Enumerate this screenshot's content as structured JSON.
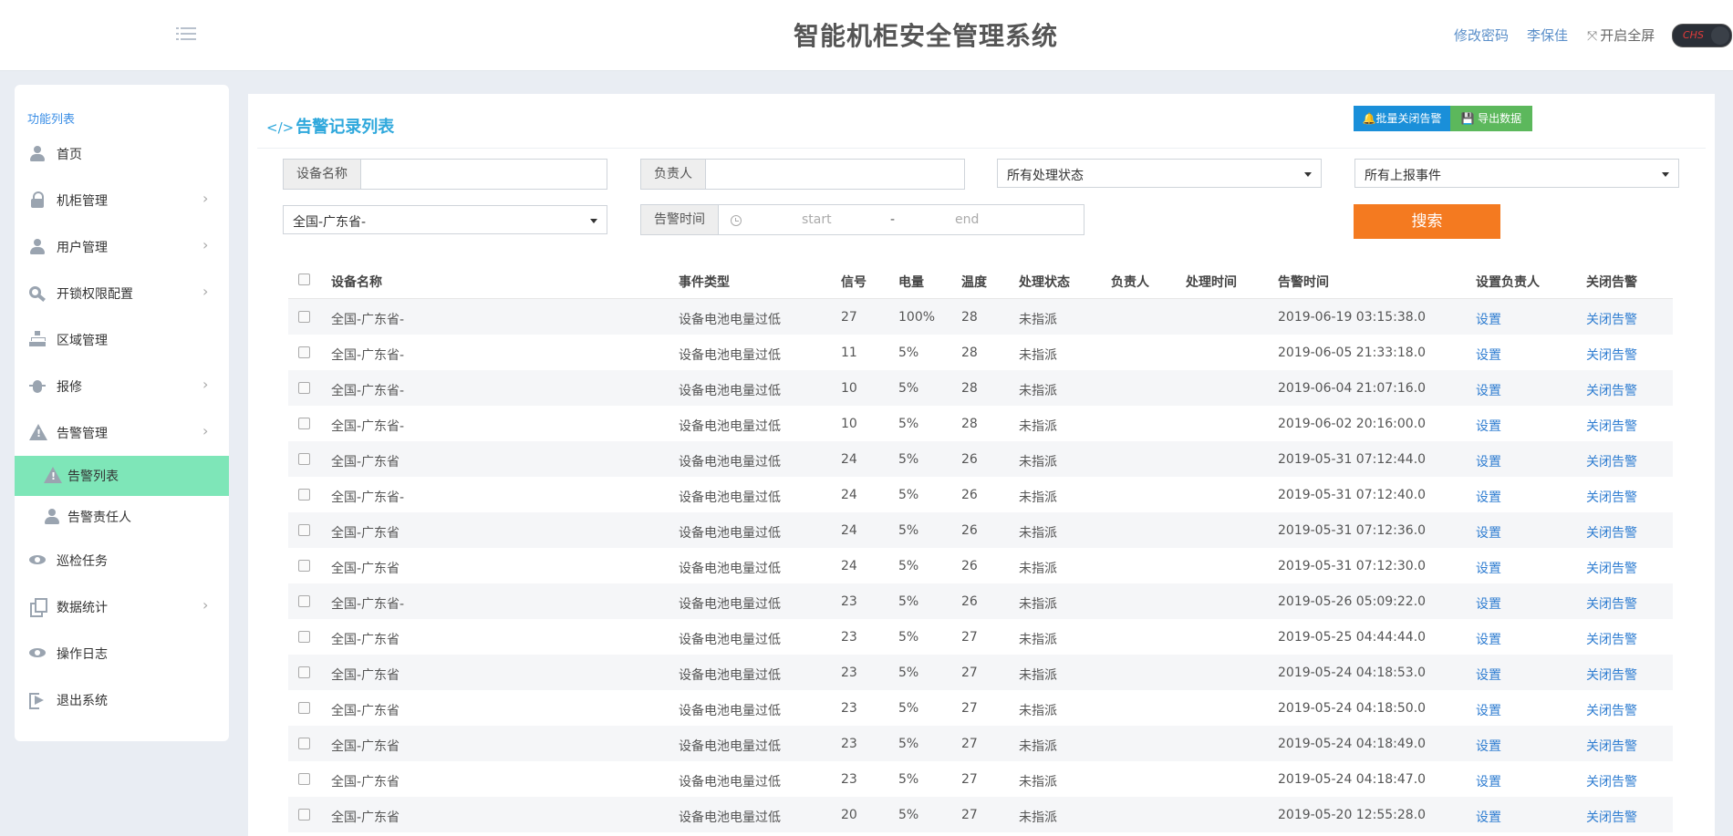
{
  "header": {
    "title": "智能机柜安全管理系统",
    "change_password": "修改密码",
    "user_name": "李保佳",
    "fullscreen": "开启全屏",
    "lang": "CHS"
  },
  "sidebar": {
    "header": "功能列表",
    "items": [
      {
        "label": "首页",
        "icon": "user-icon"
      },
      {
        "label": "机柜管理",
        "icon": "lock-icon"
      },
      {
        "label": "用户管理",
        "icon": "user-icon"
      },
      {
        "label": "开锁权限配置",
        "icon": "key-icon"
      },
      {
        "label": "区域管理",
        "icon": "sitemap-icon"
      },
      {
        "label": "报修",
        "icon": "bug-icon"
      },
      {
        "label": "告警管理",
        "icon": "warning-icon"
      },
      {
        "label": "告警列表",
        "icon": "warning-icon"
      },
      {
        "label": "告警责任人",
        "icon": "user-icon"
      },
      {
        "label": "巡检任务",
        "icon": "eye-icon"
      },
      {
        "label": "数据统计",
        "icon": "copy-icon"
      },
      {
        "label": "操作日志",
        "icon": "eye-icon"
      },
      {
        "label": "退出系统",
        "icon": "sign-out-icon"
      }
    ],
    "active_color": "#7ee6b8"
  },
  "main": {
    "title": "告警记录列表",
    "title_prefix": "</>",
    "batch_close_label": "批量关闭告警",
    "export_label": "导出数据",
    "filters": {
      "device_name_label": "设备名称",
      "device_name_value": "",
      "owner_label": "负责人",
      "owner_value": "",
      "status_select": "所有处理状态",
      "event_select": "所有上报事件",
      "region_select": "全国-广东省-",
      "alarm_time_label": "告警时间",
      "time_start_placeholder": "start",
      "time_sep": "-",
      "time_end_placeholder": "end",
      "search_label": "搜索"
    },
    "table": {
      "columns": [
        "设备名称",
        "事件类型",
        "信号",
        "电量",
        "温度",
        "处理状态",
        "负责人",
        "处理时间",
        "告警时间",
        "设置负责人",
        "关闭告警"
      ],
      "rows": [
        {
          "device": "全国-广东省-",
          "event": "设备电池电量过低",
          "signal": "27",
          "battery": "100%",
          "temp": "28",
          "status": "未指派",
          "owner": "",
          "handled": "",
          "time": "2019-06-19 03:15:38.0",
          "set": "设置",
          "close": "关闭告警"
        },
        {
          "device": "全国-广东省-",
          "event": "设备电池电量过低",
          "signal": "11",
          "battery": "5%",
          "temp": "28",
          "status": "未指派",
          "owner": "",
          "handled": "",
          "time": "2019-06-05 21:33:18.0",
          "set": "设置",
          "close": "关闭告警"
        },
        {
          "device": "全国-广东省-",
          "event": "设备电池电量过低",
          "signal": "10",
          "battery": "5%",
          "temp": "28",
          "status": "未指派",
          "owner": "",
          "handled": "",
          "time": "2019-06-04 21:07:16.0",
          "set": "设置",
          "close": "关闭告警"
        },
        {
          "device": "全国-广东省-",
          "event": "设备电池电量过低",
          "signal": "10",
          "battery": "5%",
          "temp": "28",
          "status": "未指派",
          "owner": "",
          "handled": "",
          "time": "2019-06-02 20:16:00.0",
          "set": "设置",
          "close": "关闭告警"
        },
        {
          "device": "全国-广东省",
          "event": "设备电池电量过低",
          "signal": "24",
          "battery": "5%",
          "temp": "26",
          "status": "未指派",
          "owner": "",
          "handled": "",
          "time": "2019-05-31 07:12:44.0",
          "set": "设置",
          "close": "关闭告警"
        },
        {
          "device": "全国-广东省-",
          "event": "设备电池电量过低",
          "signal": "24",
          "battery": "5%",
          "temp": "26",
          "status": "未指派",
          "owner": "",
          "handled": "",
          "time": "2019-05-31 07:12:40.0",
          "set": "设置",
          "close": "关闭告警"
        },
        {
          "device": "全国-广东省",
          "event": "设备电池电量过低",
          "signal": "24",
          "battery": "5%",
          "temp": "26",
          "status": "未指派",
          "owner": "",
          "handled": "",
          "time": "2019-05-31 07:12:36.0",
          "set": "设置",
          "close": "关闭告警"
        },
        {
          "device": "全国-广东省",
          "event": "设备电池电量过低",
          "signal": "24",
          "battery": "5%",
          "temp": "26",
          "status": "未指派",
          "owner": "",
          "handled": "",
          "time": "2019-05-31 07:12:30.0",
          "set": "设置",
          "close": "关闭告警"
        },
        {
          "device": "全国-广东省-",
          "event": "设备电池电量过低",
          "signal": "23",
          "battery": "5%",
          "temp": "26",
          "status": "未指派",
          "owner": "",
          "handled": "",
          "time": "2019-05-26 05:09:22.0",
          "set": "设置",
          "close": "关闭告警"
        },
        {
          "device": "全国-广东省",
          "event": "设备电池电量过低",
          "signal": "23",
          "battery": "5%",
          "temp": "27",
          "status": "未指派",
          "owner": "",
          "handled": "",
          "time": "2019-05-25 04:44:44.0",
          "set": "设置",
          "close": "关闭告警"
        },
        {
          "device": "全国-广东省",
          "event": "设备电池电量过低",
          "signal": "23",
          "battery": "5%",
          "temp": "27",
          "status": "未指派",
          "owner": "",
          "handled": "",
          "time": "2019-05-24 04:18:53.0",
          "set": "设置",
          "close": "关闭告警"
        },
        {
          "device": "全国-广东省",
          "event": "设备电池电量过低",
          "signal": "23",
          "battery": "5%",
          "temp": "27",
          "status": "未指派",
          "owner": "",
          "handled": "",
          "time": "2019-05-24 04:18:50.0",
          "set": "设置",
          "close": "关闭告警"
        },
        {
          "device": "全国-广东省",
          "event": "设备电池电量过低",
          "signal": "23",
          "battery": "5%",
          "temp": "27",
          "status": "未指派",
          "owner": "",
          "handled": "",
          "time": "2019-05-24 04:18:49.0",
          "set": "设置",
          "close": "关闭告警"
        },
        {
          "device": "全国-广东省",
          "event": "设备电池电量过低",
          "signal": "23",
          "battery": "5%",
          "temp": "27",
          "status": "未指派",
          "owner": "",
          "handled": "",
          "time": "2019-05-24 04:18:47.0",
          "set": "设置",
          "close": "关闭告警"
        },
        {
          "device": "全国-广东省",
          "event": "设备电池电量过低",
          "signal": "20",
          "battery": "5%",
          "temp": "27",
          "status": "未指派",
          "owner": "",
          "handled": "",
          "time": "2019-05-20 12:55:28.0",
          "set": "设置",
          "close": "关闭告警"
        }
      ]
    }
  },
  "colors": {
    "accent_blue": "#2fa8dc",
    "search_orange": "#f47a20",
    "export_green": "#5cb85c",
    "close_blue": "#1a8fd9",
    "link_blue": "#2f7dd1"
  }
}
